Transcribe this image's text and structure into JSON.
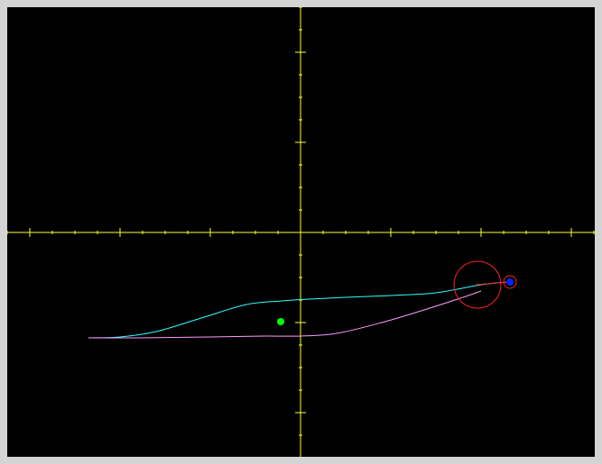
{
  "window": {
    "background_color": "#d4d4d4"
  },
  "canvas": {
    "background_color": "#000000"
  },
  "axes": {
    "color": "#ffff33",
    "x_range": [
      -3.25,
      3.25
    ],
    "y_range": [
      -2.5,
      2.5
    ],
    "minor_tick_step": 0.25,
    "major_tick_step": 1,
    "tick_labels_shown": false,
    "grid": false
  },
  "chart_data": {
    "type": "scatter",
    "series": [
      {
        "color": "#33ffff",
        "points": [
          [
            -2.35,
            -1.17
          ],
          [
            -2.0,
            -1.16
          ],
          [
            -1.6,
            -1.1
          ],
          [
            -1.1,
            -0.95
          ],
          [
            -0.6,
            -0.8
          ],
          [
            -0.2,
            -0.76
          ],
          [
            0.0,
            -0.745
          ],
          [
            0.5,
            -0.72
          ],
          [
            1.0,
            -0.7
          ],
          [
            1.5,
            -0.67
          ],
          [
            2.0,
            -0.58
          ],
          [
            2.3,
            -0.55
          ]
        ]
      },
      {
        "color": "#ff99ff",
        "points": [
          [
            -2.35,
            -1.17
          ],
          [
            -1.8,
            -1.17
          ],
          [
            -1.0,
            -1.16
          ],
          [
            -0.4,
            -1.15
          ],
          [
            0.0,
            -1.15
          ],
          [
            0.4,
            -1.12
          ],
          [
            0.9,
            -1.0
          ],
          [
            1.4,
            -0.85
          ],
          [
            1.8,
            -0.72
          ],
          [
            2.0,
            -0.65
          ]
        ]
      },
      {
        "color": "#00ff00",
        "points": [
          [
            -0.22,
            -0.99
          ]
        ]
      },
      {
        "color": "#ff3333",
        "points": [
          [
            1.95,
            -0.58
          ],
          [
            2.3,
            -0.55
          ]
        ]
      }
    ]
  },
  "markers": {
    "handle_circle": {
      "center": [
        1.96,
        -0.58
      ],
      "radius": 0.26,
      "color": "#ff2222"
    },
    "endpoint_dot": {
      "center": [
        2.32,
        -0.55
      ],
      "ring_color": "#ff2222",
      "fill_color": "#0022ff"
    }
  }
}
